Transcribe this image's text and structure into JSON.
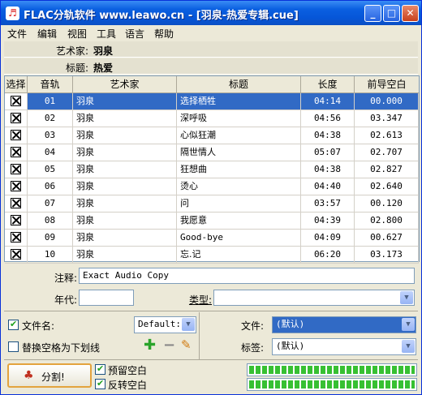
{
  "window": {
    "title": "FLAC分轨软件 www.leawo.cn - [羽泉-热爱专辑.cue]",
    "icon": "app-icon",
    "min": "_",
    "max": "□",
    "close": "✕"
  },
  "menu": [
    "文件",
    "编辑",
    "视图",
    "工具",
    "语言",
    "帮助"
  ],
  "info": {
    "artist_label": "艺术家:",
    "artist": "羽泉",
    "title_label": "标题:",
    "title": "热爱"
  },
  "table": {
    "headers": [
      "选择",
      "音轨",
      "艺术家",
      "标题",
      "长度",
      "前导空白"
    ],
    "rows": [
      {
        "track": "01",
        "artist": "羽泉",
        "title": "选择栖牲",
        "length": "04:14",
        "gap": "00.000",
        "checked": true,
        "selected": true
      },
      {
        "track": "02",
        "artist": "羽泉",
        "title": "深呼吸",
        "length": "04:56",
        "gap": "03.347",
        "checked": true
      },
      {
        "track": "03",
        "artist": "羽泉",
        "title": "心似狂潮",
        "length": "04:38",
        "gap": "02.613",
        "checked": true
      },
      {
        "track": "04",
        "artist": "羽泉",
        "title": "隔世情人",
        "length": "05:07",
        "gap": "02.707",
        "checked": true
      },
      {
        "track": "05",
        "artist": "羽泉",
        "title": "狂想曲",
        "length": "04:38",
        "gap": "02.827",
        "checked": true
      },
      {
        "track": "06",
        "artist": "羽泉",
        "title": "烫心",
        "length": "04:40",
        "gap": "02.640",
        "checked": true
      },
      {
        "track": "07",
        "artist": "羽泉",
        "title": "问",
        "length": "03:57",
        "gap": "00.120",
        "checked": true
      },
      {
        "track": "08",
        "artist": "羽泉",
        "title": "我愿意",
        "length": "04:39",
        "gap": "02.800",
        "checked": true
      },
      {
        "track": "09",
        "artist": "羽泉",
        "title": "Good-bye",
        "length": "04:09",
        "gap": "00.627",
        "checked": true
      },
      {
        "track": "10",
        "artist": "羽泉",
        "title": "忘.记",
        "length": "06:20",
        "gap": "03.173",
        "checked": true
      }
    ]
  },
  "form": {
    "comment_label": "注释:",
    "comment": "Exact Audio Copy",
    "year_label": "年代:",
    "year": "",
    "genre_label": "类型:",
    "genre": ""
  },
  "options": {
    "filename_label": "文件名:",
    "filename_checked": true,
    "filename_value": "Default:",
    "replace_label": "替换空格为下划线",
    "replace_checked": false,
    "file_label": "文件:",
    "file_value": "(默认)",
    "tag_label": "标签:",
    "tag_value": "(默认)",
    "split_label": "分割!",
    "keep_gap_label": "预留空白",
    "keep_gap_checked": true,
    "reverse_gap_label": "反转空白",
    "reverse_gap_checked": true,
    "progress1": 1.0,
    "progress2": 1.0
  },
  "colors": {
    "selection": "#316ac5",
    "titlebar": "#0a5fe0",
    "progress": "#37c032"
  }
}
